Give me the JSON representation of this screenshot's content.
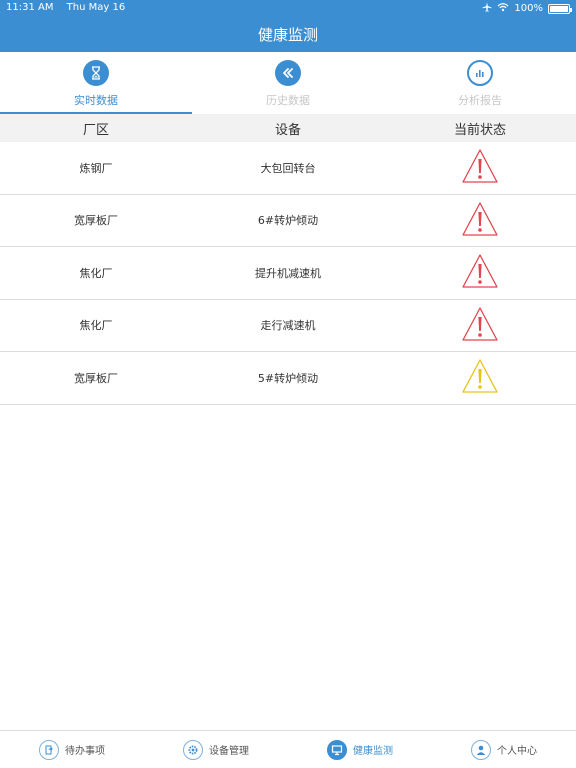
{
  "status_bar": {
    "time": "11:31 AM",
    "date": "Thu May 16",
    "battery": "100%",
    "battery_level": 1.0
  },
  "nav": {
    "title": "健康监测"
  },
  "tabs": [
    {
      "label": "实时数据",
      "icon": "hourglass-icon",
      "active": true
    },
    {
      "label": "历史数据",
      "icon": "double-chevron-left-icon",
      "active": false
    },
    {
      "label": "分析报告",
      "icon": "refresh-chart-icon",
      "active": false
    }
  ],
  "table": {
    "headers": {
      "area": "厂区",
      "device": "设备",
      "status": "当前状态"
    },
    "rows": [
      {
        "area": "炼钢厂",
        "device": "大包回转台",
        "status": "alarm-red"
      },
      {
        "area": "宽厚板厂",
        "device": "6#转炉倾动",
        "status": "alarm-red"
      },
      {
        "area": "焦化厂",
        "device": "提升机减速机",
        "status": "alarm-red"
      },
      {
        "area": "焦化厂",
        "device": "走行减速机",
        "status": "alarm-red"
      },
      {
        "area": "宽厚板厂",
        "device": "5#转炉倾动",
        "status": "warning-yellow"
      }
    ]
  },
  "bottom_tabs": [
    {
      "label": "待办事项",
      "icon": "todo-icon",
      "active": false
    },
    {
      "label": "设备管理",
      "icon": "gear-icon",
      "active": false
    },
    {
      "label": "健康监测",
      "icon": "monitor-icon",
      "active": true
    },
    {
      "label": "个人中心",
      "icon": "person-icon",
      "active": false
    }
  ],
  "colors": {
    "brand": "#3c8ed2",
    "alarm_red": "#e0464e",
    "warning_yellow": "#e8c21a"
  }
}
